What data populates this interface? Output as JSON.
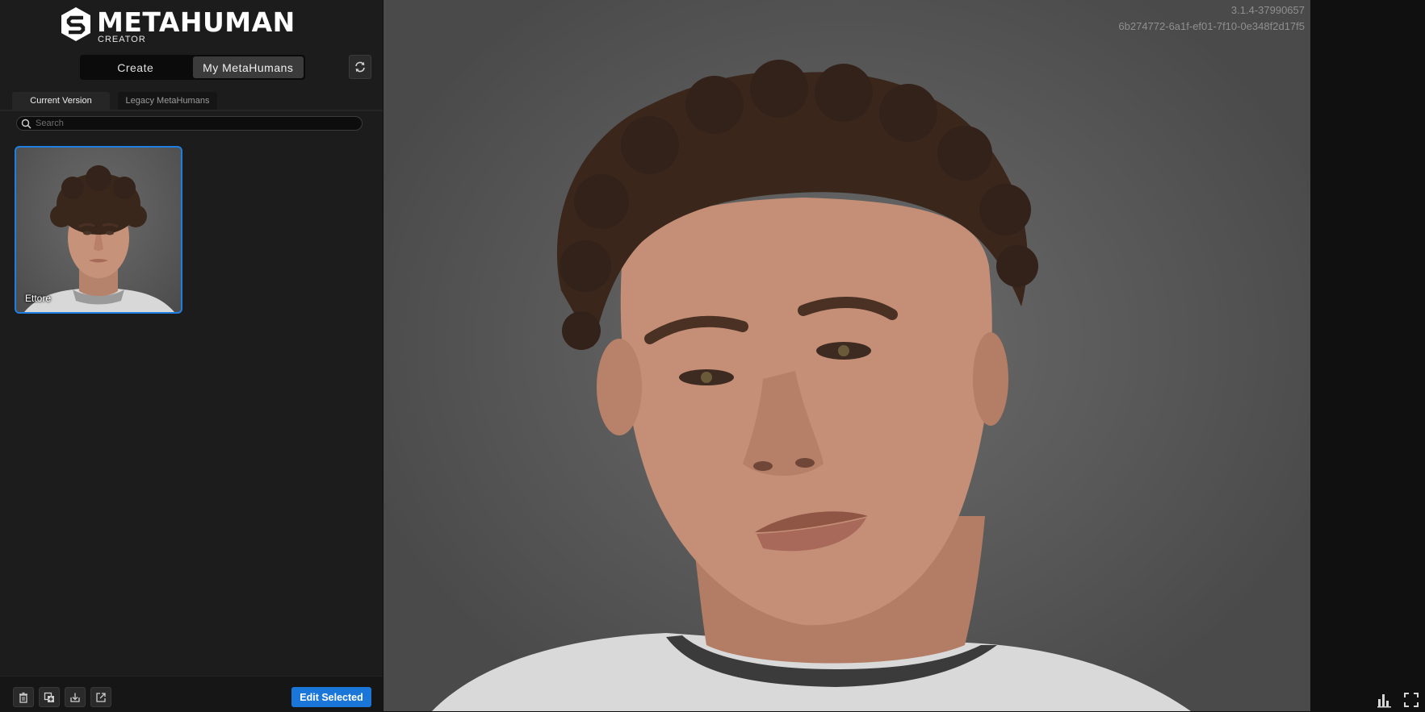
{
  "app": {
    "brand_name": "METAHUMAN",
    "brand_subtitle": "CREATOR"
  },
  "header": {
    "mode_tabs": [
      {
        "label": "Create",
        "active": false
      },
      {
        "label": "My MetaHumans",
        "active": true
      }
    ],
    "refresh_icon": "refresh-icon"
  },
  "library": {
    "tabs": [
      {
        "label": "Current Version",
        "active": true
      },
      {
        "label": "Legacy MetaHumans",
        "active": false
      }
    ],
    "search": {
      "placeholder": "Search",
      "value": ""
    },
    "items": [
      {
        "name": "Ettore",
        "selected": true
      }
    ]
  },
  "toolbar": {
    "icons": [
      "trash-icon",
      "duplicate-icon",
      "import-icon",
      "export-icon"
    ],
    "edit_label": "Edit Selected"
  },
  "viewport": {
    "version": "3.1.4-37990657",
    "build_hash": "6b274772-6a1f-ef01-7f10-0e348f2d17f5",
    "corner_icons": [
      "stats-icon",
      "fullscreen-icon"
    ]
  },
  "colors": {
    "accent": "#1a76d9",
    "selection_border": "#1e7fe0",
    "panel_bg": "#1c1c1c"
  }
}
